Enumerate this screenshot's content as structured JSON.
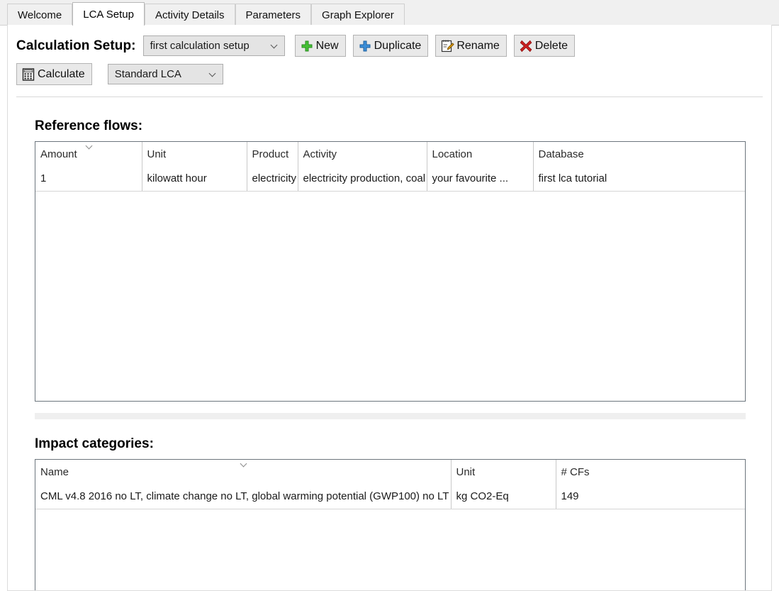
{
  "tabs": [
    {
      "label": "Welcome",
      "active": false
    },
    {
      "label": "LCA Setup",
      "active": true
    },
    {
      "label": "Activity Details",
      "active": false
    },
    {
      "label": "Parameters",
      "active": false
    },
    {
      "label": "Graph Explorer",
      "active": false
    }
  ],
  "toolbar": {
    "setup_label": "Calculation Setup:",
    "setup_combo_value": "first calculation setup",
    "new_label": "New",
    "duplicate_label": "Duplicate",
    "rename_label": "Rename",
    "delete_label": "Delete",
    "calculate_label": "Calculate",
    "lca_combo_value": "Standard LCA",
    "icons": {
      "new": "green-plus-icon",
      "duplicate": "blue-plus-icon",
      "rename": "notepad-pencil-icon",
      "delete": "red-x-icon",
      "calculate": "calculator-icon",
      "dropdown": "chevron-down-icon"
    },
    "colors": {
      "new_plus": "#3fbb2e",
      "duplicate_plus": "#2f7fd6",
      "delete_x": "#cc1f1f",
      "rename_pencil": "#f0a500"
    }
  },
  "reference_flows": {
    "title": "Reference flows:",
    "columns": [
      "Amount",
      "Unit",
      "Product",
      "Activity",
      "Location",
      "Database"
    ],
    "sorted_column": "Amount",
    "rows": [
      {
        "amount": "1",
        "unit": "kilowatt hour",
        "product": "electricity",
        "activity": "electricity production, coal",
        "location": "your favourite ...",
        "database": "first lca tutorial"
      }
    ]
  },
  "impact_categories": {
    "title": "Impact categories:",
    "columns": [
      "Name",
      "Unit",
      "# CFs"
    ],
    "sorted_column": "Name",
    "rows": [
      {
        "name": "CML v4.8 2016 no LT, climate change no LT, global warming potential (GWP100) no LT",
        "unit": "kg CO2-Eq",
        "cfs": "149"
      }
    ]
  }
}
